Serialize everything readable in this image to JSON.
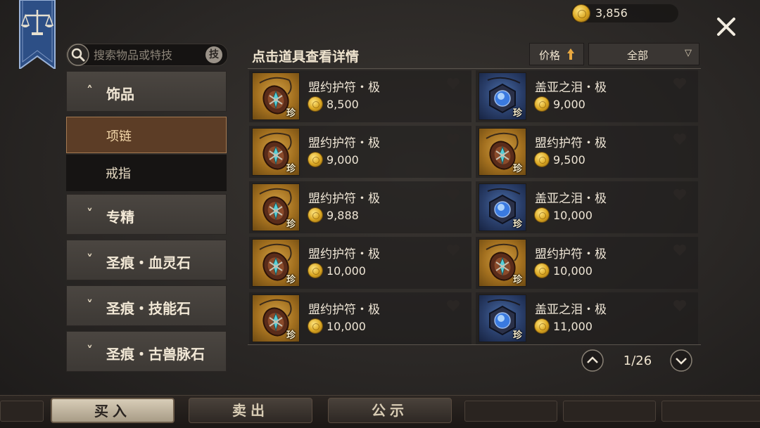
{
  "currency": {
    "amount": "3,856",
    "icon": "gold-coin-icon"
  },
  "search": {
    "placeholder": "搜索物品或特技",
    "skill_button": "技"
  },
  "sidebar": {
    "categories": [
      {
        "label": "饰品",
        "expanded": true
      },
      {
        "label": "专精",
        "expanded": false
      },
      {
        "label": "圣痕・血灵石",
        "expanded": false
      },
      {
        "label": "圣痕・技能石",
        "expanded": false
      },
      {
        "label": "圣痕・古兽脉石",
        "expanded": false
      }
    ],
    "subitems": [
      {
        "label": "项链",
        "selected": true
      },
      {
        "label": "戒指",
        "selected": false
      }
    ]
  },
  "list": {
    "title": "点击道具查看详情",
    "sort_label": "价格",
    "filter_label": "全部",
    "rarity_badge": "珍",
    "items": [
      {
        "name": "盟约护符・极",
        "price": "8,500",
        "icon": "amulet-gold"
      },
      {
        "name": "盖亚之泪・极",
        "price": "9,000",
        "icon": "gem-blue"
      },
      {
        "name": "盟约护符・极",
        "price": "9,000",
        "icon": "amulet-gold"
      },
      {
        "name": "盟约护符・极",
        "price": "9,500",
        "icon": "amulet-gold"
      },
      {
        "name": "盟约护符・极",
        "price": "9,888",
        "icon": "amulet-gold"
      },
      {
        "name": "盖亚之泪・极",
        "price": "10,000",
        "icon": "gem-blue"
      },
      {
        "name": "盟约护符・极",
        "price": "10,000",
        "icon": "amulet-gold"
      },
      {
        "name": "盟约护符・极",
        "price": "10,000",
        "icon": "amulet-gold"
      },
      {
        "name": "盟约护符・极",
        "price": "10,000",
        "icon": "amulet-gold"
      },
      {
        "name": "盖亚之泪・极",
        "price": "11,000",
        "icon": "gem-blue"
      }
    ]
  },
  "pagination": {
    "current": 1,
    "total": 26,
    "text": "1/26"
  },
  "tabs": [
    {
      "label": "买入",
      "active": true
    },
    {
      "label": "卖出",
      "active": false
    },
    {
      "label": "公示",
      "active": false
    }
  ],
  "colors": {
    "accent_selected": "#5c3d26",
    "gold": "#d9a520",
    "gem_blue": "#2a3f6b"
  }
}
